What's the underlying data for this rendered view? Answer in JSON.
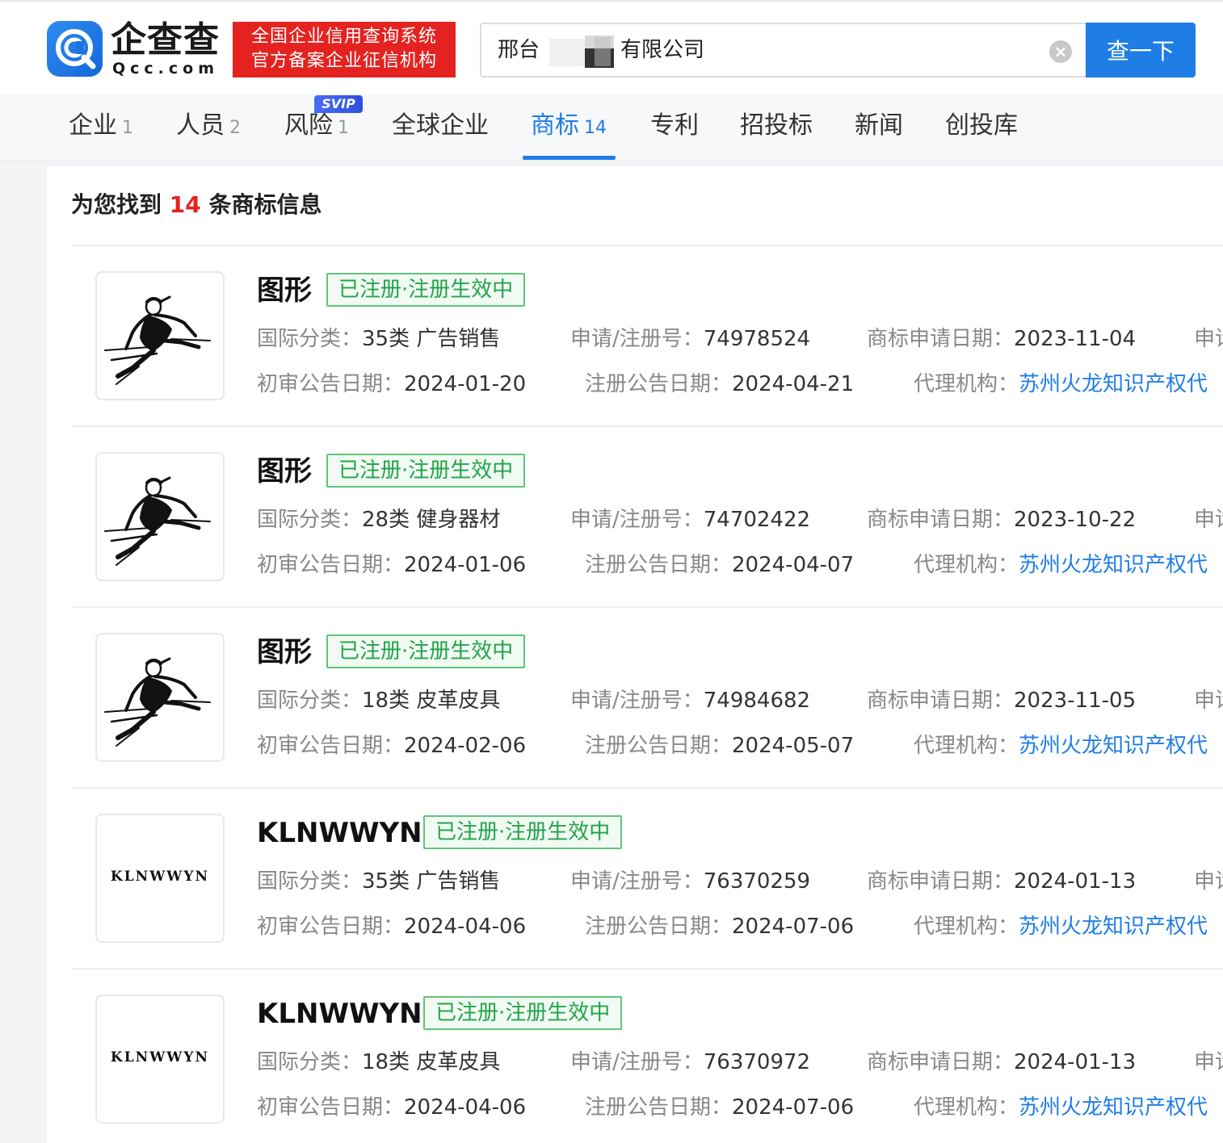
{
  "brand": {
    "name_cn": "企查查",
    "name_en": "Qcc.com",
    "badge_line1": "全国企业信用查询系统",
    "badge_line2": "官方备案企业征信机构",
    "primary_color": "#1f7de6",
    "badge_color": "#e42320"
  },
  "search": {
    "value_prefix": "邢台",
    "value_suffix": "有限公司",
    "clear_icon": "×",
    "button_label": "查一下"
  },
  "tabs": [
    {
      "label": "企业",
      "count": "1"
    },
    {
      "label": "人员",
      "count": "2"
    },
    {
      "label": "风险",
      "count": "1",
      "badge": "SVIP"
    },
    {
      "label": "全球企业",
      "count": ""
    },
    {
      "label": "商标",
      "count": "14",
      "active": true
    },
    {
      "label": "专利",
      "count": ""
    },
    {
      "label": "招投标",
      "count": ""
    },
    {
      "label": "新闻",
      "count": ""
    },
    {
      "label": "创投库",
      "count": ""
    }
  ],
  "results": {
    "prefix": "为您找到",
    "count": "14",
    "suffix": "条商标信息"
  },
  "labels": {
    "class": "国际分类：",
    "reg_no": "申请/注册号：",
    "apply_date": "商标申请日期：",
    "prelim_date": "初审公告日期：",
    "reg_date": "注册公告日期：",
    "agent": "代理机构：",
    "cut_label": "申请"
  },
  "trademarks": [
    {
      "name": "图形",
      "logo": "athlete-figure",
      "status": "已注册·注册生效中",
      "class": "35类 广告销售",
      "reg_no": "74978524",
      "apply_date": "2023-11-04",
      "prelim_date": "2024-01-20",
      "reg_date": "2024-04-21",
      "agent": "苏州火龙知识产权代"
    },
    {
      "name": "图形",
      "logo": "athlete-figure",
      "status": "已注册·注册生效中",
      "class": "28类 健身器材",
      "reg_no": "74702422",
      "apply_date": "2023-10-22",
      "prelim_date": "2024-01-06",
      "reg_date": "2024-04-07",
      "agent": "苏州火龙知识产权代"
    },
    {
      "name": "图形",
      "logo": "athlete-figure",
      "status": "已注册·注册生效中",
      "class": "18类 皮革皮具",
      "reg_no": "74984682",
      "apply_date": "2023-11-05",
      "prelim_date": "2024-02-06",
      "reg_date": "2024-05-07",
      "agent": "苏州火龙知识产权代"
    },
    {
      "name": "KLNWWYN",
      "logo": "KLNWWYN",
      "status": "已注册·注册生效中",
      "class": "35类 广告销售",
      "reg_no": "76370259",
      "apply_date": "2024-01-13",
      "prelim_date": "2024-04-06",
      "reg_date": "2024-07-06",
      "agent": "苏州火龙知识产权代"
    },
    {
      "name": "KLNWWYN",
      "logo": "KLNWWYN",
      "status": "已注册·注册生效中",
      "class": "18类 皮革皮具",
      "reg_no": "76370972",
      "apply_date": "2024-01-13",
      "prelim_date": "2024-04-06",
      "reg_date": "2024-07-06",
      "agent": "苏州火龙知识产权代"
    }
  ]
}
